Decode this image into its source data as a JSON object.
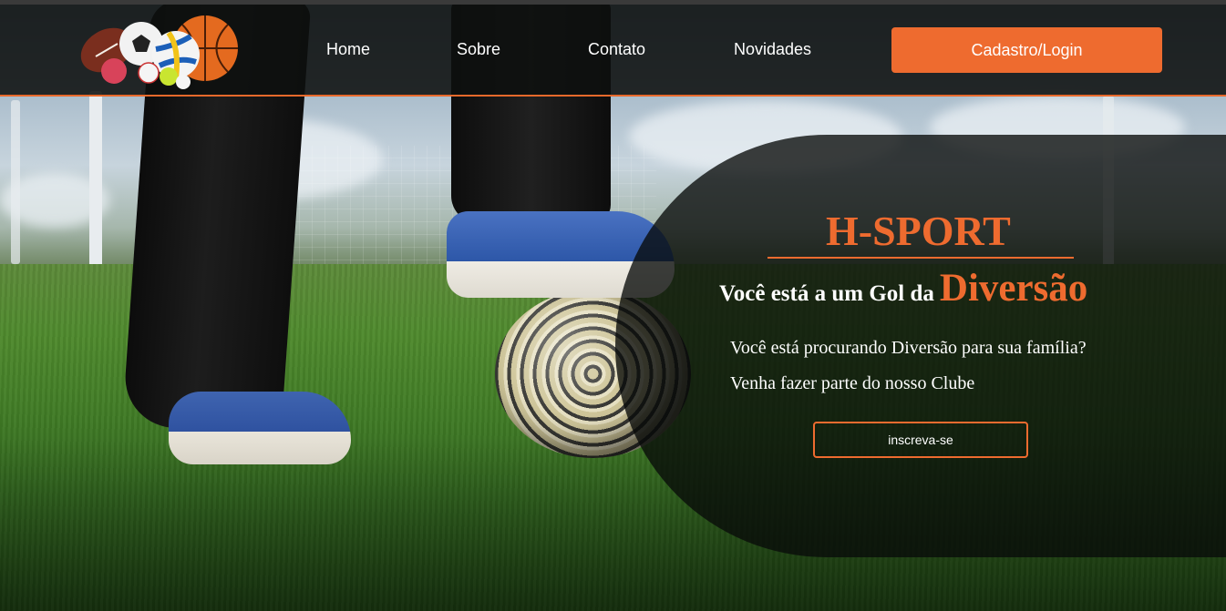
{
  "header": {
    "logo_alt": "sports-balls-logo",
    "nav": [
      {
        "label": "Home"
      },
      {
        "label": "Sobre"
      },
      {
        "label": "Contato"
      },
      {
        "label": "Novidades"
      }
    ],
    "cta_label": "Cadastro/Login"
  },
  "hero": {
    "brand": "H-SPORT",
    "tagline_prefix": "Você está a um Gol da",
    "tagline_accent": "Diversão",
    "line1": "Você está procurando Diversão para sua família?",
    "line2": "Venha fazer parte do nosso Clube",
    "signup_label": "inscreva-se"
  },
  "colors": {
    "accent": "#ee6b2f",
    "header_bg": "#0e100f",
    "text": "#ffffff"
  }
}
